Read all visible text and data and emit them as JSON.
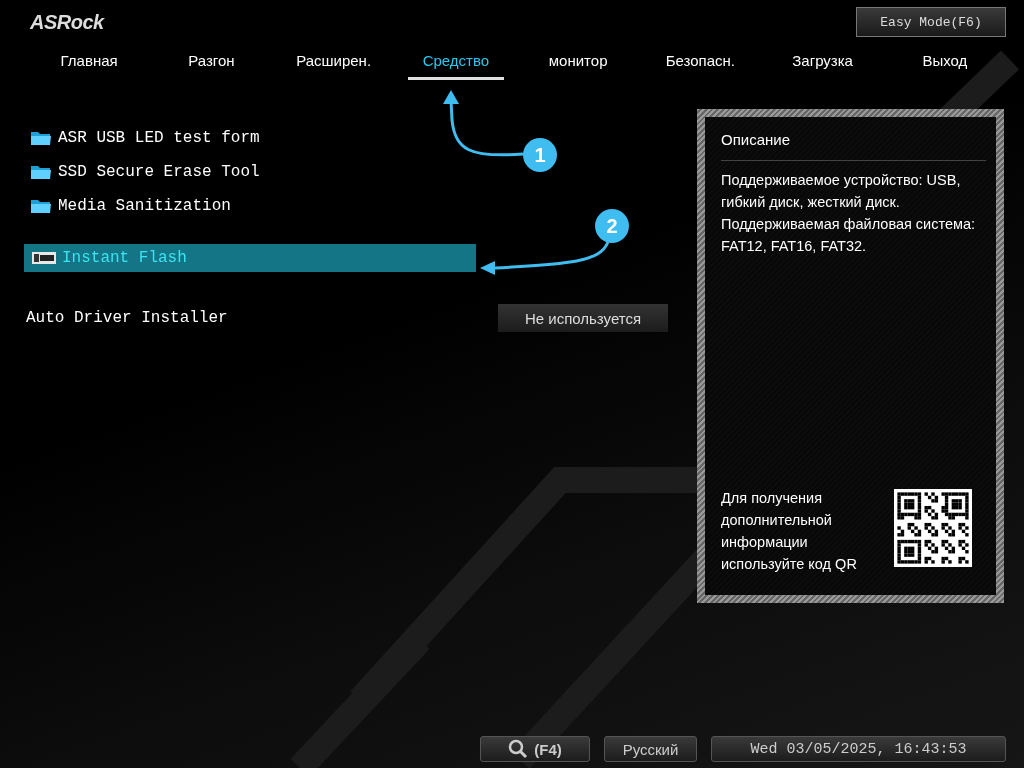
{
  "header": {
    "logo": "ASRock",
    "mode_button": "Easy Mode(F6)"
  },
  "tabs": [
    {
      "label": "Главная",
      "selected": false
    },
    {
      "label": "Разгон",
      "selected": false
    },
    {
      "label": "Расширен.",
      "selected": false
    },
    {
      "label": "Средство",
      "selected": true
    },
    {
      "label": "монитор",
      "selected": false
    },
    {
      "label": "Безопасн.",
      "selected": false
    },
    {
      "label": "Загрузка",
      "selected": false
    },
    {
      "label": "Выход",
      "selected": false
    }
  ],
  "items": [
    {
      "kind": "folder",
      "label": "ASR USB LED test form",
      "selected": false
    },
    {
      "kind": "folder",
      "label": "SSD Secure Erase Tool",
      "selected": false
    },
    {
      "kind": "folder",
      "label": "Media Sanitization",
      "selected": false
    },
    {
      "kind": "bios",
      "label": "Instant Flash",
      "selected": true
    },
    {
      "kind": "option",
      "label": "Auto Driver Installer",
      "value": "Не используется",
      "selected": false
    }
  ],
  "description": {
    "title": "Описание",
    "text": "Поддерживаемое устройство: USB, гибкий диск, жесткий диск. Поддерживаемая файловая система: FAT12, FAT16, FAT32.",
    "qr_text": "Для получения дополнительной информации используйте код QR"
  },
  "annotations": [
    {
      "label": "1"
    },
    {
      "label": "2"
    }
  ],
  "footer": {
    "search_key": "(F4)",
    "language": "Русский",
    "datetime": "Wed 03/05/2025, 16:43:53"
  }
}
